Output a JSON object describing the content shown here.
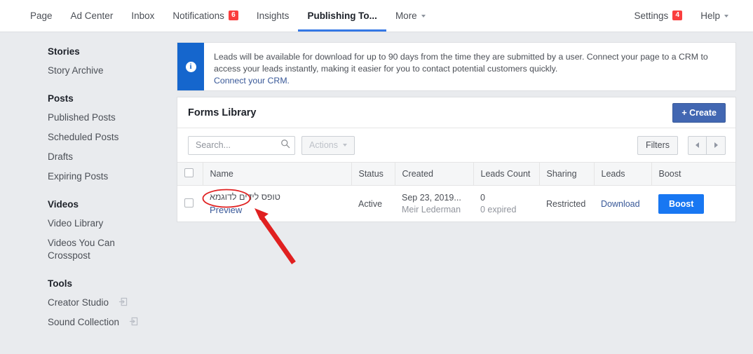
{
  "topnav": {
    "left_items": [
      {
        "label": "Page",
        "active": false
      },
      {
        "label": "Ad Center",
        "active": false
      },
      {
        "label": "Inbox",
        "active": false
      },
      {
        "label": "Notifications",
        "badge": "6",
        "active": false
      },
      {
        "label": "Insights",
        "active": false
      },
      {
        "label": "Publishing To...",
        "active": true
      },
      {
        "label": "More",
        "caret": true,
        "active": false
      }
    ],
    "right_items": [
      {
        "label": "Settings",
        "badge": "4"
      },
      {
        "label": "Help",
        "caret": true
      }
    ]
  },
  "sidebar": {
    "groups": [
      {
        "title": "Stories",
        "items": [
          {
            "label": "Story Archive",
            "external": false
          }
        ]
      },
      {
        "title": "Posts",
        "items": [
          {
            "label": "Published Posts",
            "external": false
          },
          {
            "label": "Scheduled Posts",
            "external": false
          },
          {
            "label": "Drafts",
            "external": false
          },
          {
            "label": "Expiring Posts",
            "external": false
          }
        ]
      },
      {
        "title": "Videos",
        "items": [
          {
            "label": "Video Library",
            "external": false
          },
          {
            "label": "Videos You Can Crosspost",
            "external": false
          }
        ]
      },
      {
        "title": "Tools",
        "items": [
          {
            "label": "Creator Studio",
            "external": true
          },
          {
            "label": "Sound Collection",
            "external": true
          }
        ]
      }
    ]
  },
  "banner": {
    "icon": "info-icon",
    "text": "Leads will be available for download for up to 90 days from the time they are submitted by a user. Connect your page to a CRM to access your leads instantly, making it easier for you to contact potential customers quickly.",
    "link": "Connect your CRM.",
    "accent_color": "#1566cd"
  },
  "card": {
    "title": "Forms Library",
    "create_label": "+ Create"
  },
  "toolbar": {
    "search_placeholder": "Search...",
    "search_value": "",
    "actions_label": "Actions",
    "filters_label": "Filters",
    "prev_label": "◀",
    "next_label": "▶"
  },
  "table": {
    "columns": [
      "Name",
      "Status",
      "Created",
      "Leads Count",
      "Sharing",
      "Leads",
      "Boost"
    ],
    "rows": [
      {
        "name": "טופס לידים לדוגמא",
        "preview": "Preview",
        "status": "Active",
        "created_date": "Sep 23, 2019...",
        "created_by": "Meir Lederman",
        "leads_count": "0",
        "leads_expired": "0 expired",
        "sharing": "Restricted",
        "leads": "Download",
        "boost": "Boost"
      }
    ]
  },
  "annotations": {
    "highlight_target": "Preview",
    "highlight_color": "#e02020",
    "arrow_color": "#e02020"
  }
}
